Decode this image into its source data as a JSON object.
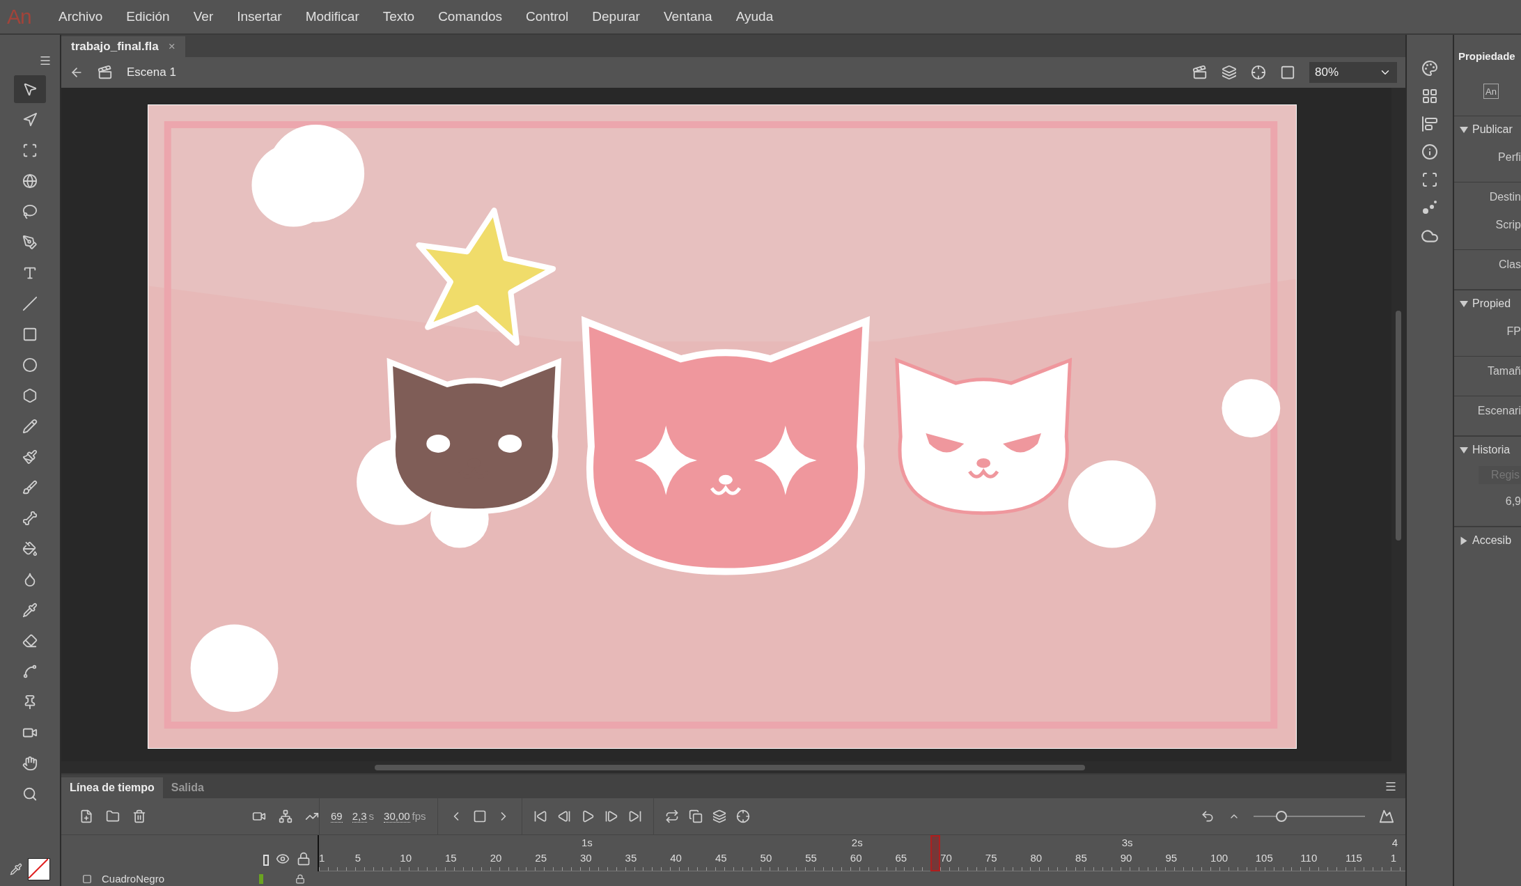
{
  "app": {
    "logo": "An"
  },
  "menu": [
    "Archivo",
    "Edición",
    "Ver",
    "Insertar",
    "Modificar",
    "Texto",
    "Comandos",
    "Control",
    "Depurar",
    "Ventana",
    "Ayuda"
  ],
  "document_tab": {
    "title": "trabajo_final.fla",
    "close": "×"
  },
  "scene": {
    "label": "Escena 1"
  },
  "zoom": {
    "value": "80%"
  },
  "tools": [
    {
      "kind": "selection",
      "selected": true
    },
    {
      "kind": "subselection",
      "selected": false
    },
    {
      "kind": "transform",
      "selected": false
    },
    {
      "kind": "rotate3d",
      "selected": false
    },
    {
      "kind": "lasso",
      "selected": false
    },
    {
      "kind": "pen",
      "selected": false
    },
    {
      "kind": "text",
      "selected": false
    },
    {
      "kind": "line",
      "selected": false
    },
    {
      "kind": "rectangle",
      "selected": false
    },
    {
      "kind": "oval",
      "selected": false
    },
    {
      "kind": "polystar",
      "selected": false
    },
    {
      "kind": "pencil",
      "selected": false
    },
    {
      "kind": "paintbrush",
      "selected": false
    },
    {
      "kind": "brush",
      "selected": false
    },
    {
      "kind": "bone",
      "selected": false
    },
    {
      "kind": "bucket",
      "selected": false
    },
    {
      "kind": "inkbottle",
      "selected": false
    },
    {
      "kind": "eyedropper",
      "selected": false
    },
    {
      "kind": "eraser",
      "selected": false
    },
    {
      "kind": "width",
      "selected": false
    },
    {
      "kind": "pin",
      "selected": false
    },
    {
      "kind": "camera",
      "selected": false
    },
    {
      "kind": "hand",
      "selected": false
    },
    {
      "kind": "zoom",
      "selected": false
    }
  ],
  "properties": {
    "title": "Propiedade",
    "badge": "An",
    "sections": [
      {
        "title": "Publicar",
        "expanded": true,
        "groups": [
          [
            "Perfi"
          ],
          [
            "Destin",
            "Scrip"
          ],
          [
            "Clas"
          ]
        ]
      },
      {
        "title": "Propied",
        "expanded": true,
        "groups": [
          [
            "FP"
          ],
          [
            "Tamañ"
          ],
          [
            "Escenari"
          ]
        ]
      },
      {
        "title": "Historia",
        "expanded": true,
        "button": "Regis",
        "groups": [
          [
            "6,9"
          ]
        ]
      },
      {
        "title": "Accesib",
        "expanded": false
      }
    ]
  },
  "timeline": {
    "tabs": [
      {
        "label": "Línea de tiempo",
        "selected": true
      },
      {
        "label": "Salida",
        "selected": false
      }
    ],
    "frame": "69",
    "time": "2,3",
    "time_unit": "s",
    "fps": "30,00",
    "fps_unit": "fps",
    "seconds": [
      "1s",
      "2s",
      "3s",
      "4"
    ],
    "frame_labels": [
      "1",
      "5",
      "10",
      "15",
      "20",
      "25",
      "30",
      "35",
      "40",
      "45",
      "50",
      "55",
      "60",
      "65",
      "70",
      "75",
      "80",
      "85",
      "90",
      "95",
      "100",
      "105",
      "110",
      "115",
      "1"
    ],
    "playhead": {
      "level": 0.567
    },
    "zoom_slider": {
      "level": 0.2
    },
    "layers": [
      {
        "name": "CuadroNegro",
        "color": "#6aa321",
        "locked": true
      }
    ]
  }
}
